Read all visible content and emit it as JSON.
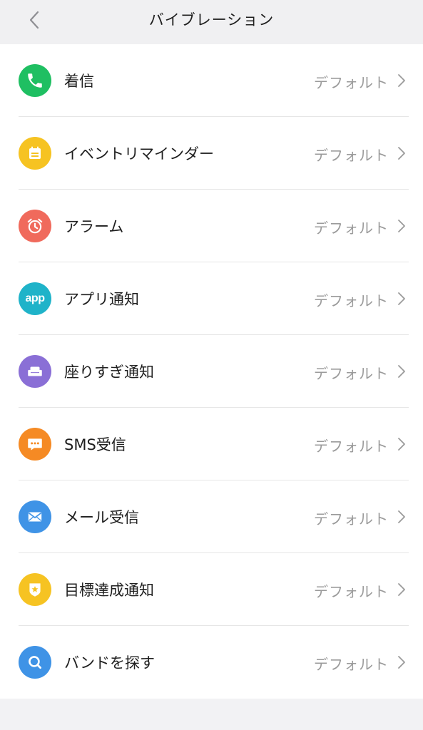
{
  "header": {
    "title": "バイブレーション",
    "back_icon": "chevron-left-icon"
  },
  "items": [
    {
      "label": "着信",
      "value": "デフォルト",
      "icon": "phone-icon",
      "color": "#1fbf62"
    },
    {
      "label": "イベントリマインダー",
      "value": "デフォルト",
      "icon": "calendar-icon",
      "color": "#f6c322"
    },
    {
      "label": "アラーム",
      "value": "デフォルト",
      "icon": "alarm-clock-icon",
      "color": "#f06a5c"
    },
    {
      "label": "アプリ通知",
      "value": "デフォルト",
      "icon": "app-icon",
      "color": "#1fb3c9",
      "icon_text": "app"
    },
    {
      "label": "座りすぎ通知",
      "value": "デフォルト",
      "icon": "sofa-icon",
      "color": "#8a6fd6"
    },
    {
      "label": "SMS受信",
      "value": "デフォルト",
      "icon": "message-icon",
      "color": "#f58a24"
    },
    {
      "label": "メール受信",
      "value": "デフォルト",
      "icon": "mail-icon",
      "color": "#3f93e6"
    },
    {
      "label": "目標達成通知",
      "value": "デフォルト",
      "icon": "badge-star-icon",
      "color": "#f6c322"
    },
    {
      "label": "バンドを探す",
      "value": "デフォルト",
      "icon": "search-icon",
      "color": "#3f93e6"
    }
  ]
}
